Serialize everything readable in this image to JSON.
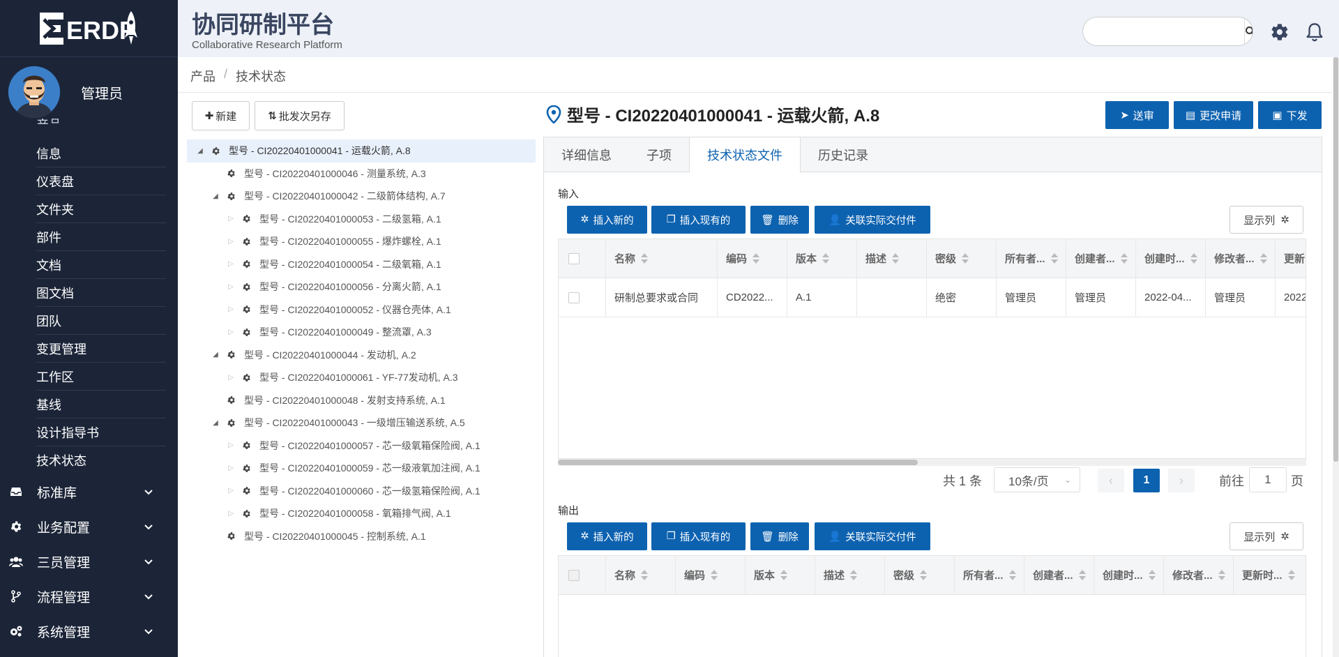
{
  "app": {
    "logo_text": "ERDP",
    "title": "协同研制平台",
    "subtitle": "Collaborative Research Platform",
    "search_placeholder": ""
  },
  "user": {
    "name": "管理员"
  },
  "sidebar": {
    "partial_label": "产品",
    "sub_items": [
      "信息",
      "仪表盘",
      "文件夹",
      "部件",
      "文档",
      "图文档",
      "团队",
      "变更管理",
      "工作区",
      "基线",
      "设计指导书",
      "技术状态"
    ],
    "main_items": [
      {
        "label": "标准库",
        "icon": "inbox-icon"
      },
      {
        "label": "业务配置",
        "icon": "gear-icon"
      },
      {
        "label": "三员管理",
        "icon": "users-icon"
      },
      {
        "label": "流程管理",
        "icon": "branch-icon"
      },
      {
        "label": "系统管理",
        "icon": "cogs-icon"
      }
    ]
  },
  "breadcrumb": {
    "items": [
      "产品",
      "技术状态"
    ],
    "separator": "/"
  },
  "left_toolbar": {
    "new_label": "新建",
    "batch_label": "批发次另存"
  },
  "tree": [
    {
      "level": 0,
      "toggle": "expanded",
      "label": "型号 - CI20220401000041 - 运载火箭, A.8",
      "selected": true
    },
    {
      "level": 1,
      "toggle": "none",
      "label": "型号 - CI20220401000046 - 测量系统, A.3"
    },
    {
      "level": 1,
      "toggle": "expanded",
      "label": "型号 - CI20220401000042 - 二级箭体结构, A.7"
    },
    {
      "level": 2,
      "toggle": "collapsed",
      "label": "型号 - CI20220401000053 - 二级氢箱, A.1"
    },
    {
      "level": 2,
      "toggle": "collapsed",
      "label": "型号 - CI20220401000055 - 爆炸螺栓, A.1"
    },
    {
      "level": 2,
      "toggle": "collapsed",
      "label": "型号 - CI20220401000054 - 二级氧箱, A.1"
    },
    {
      "level": 2,
      "toggle": "collapsed",
      "label": "型号 - CI20220401000056 - 分离火箭, A.1"
    },
    {
      "level": 2,
      "toggle": "collapsed",
      "label": "型号 - CI20220401000052 - 仪器仓壳体, A.1"
    },
    {
      "level": 2,
      "toggle": "collapsed",
      "label": "型号 - CI20220401000049 - 整流罩, A.3"
    },
    {
      "level": 1,
      "toggle": "expanded",
      "label": "型号 - CI20220401000044 - 发动机, A.2"
    },
    {
      "level": 2,
      "toggle": "collapsed",
      "label": "型号 - CI20220401000061 - YF-77发动机, A.3"
    },
    {
      "level": 1,
      "toggle": "none",
      "label": "型号 - CI20220401000048 - 发射支持系统, A.1"
    },
    {
      "level": 1,
      "toggle": "expanded",
      "label": "型号 - CI20220401000043 - 一级增压输送系统, A.5"
    },
    {
      "level": 2,
      "toggle": "collapsed",
      "label": "型号 - CI20220401000057 - 芯一级氧箱保险阀, A.1"
    },
    {
      "level": 2,
      "toggle": "collapsed",
      "label": "型号 - CI20220401000059 - 芯一级液氧加注阀, A.1"
    },
    {
      "level": 2,
      "toggle": "collapsed",
      "label": "型号 - CI20220401000060 - 芯一级氢箱保险阀, A.1"
    },
    {
      "level": 2,
      "toggle": "collapsed",
      "label": "型号 - CI20220401000058 - 氧箱排气阀, A.1"
    },
    {
      "level": 1,
      "toggle": "none",
      "label": "型号 - CI20220401000045 - 控制系统, A.1"
    }
  ],
  "detail": {
    "title": "型号 - CI20220401000041 - 运载火箭, A.8",
    "actions": {
      "submit": "送审",
      "change_request": "更改申请",
      "issue": "下发"
    },
    "tabs": [
      "详细信息",
      "子项",
      "技术状态文件",
      "历史记录"
    ],
    "active_tab": 2
  },
  "input_section": {
    "label": "输入",
    "buttons": {
      "insert_new": "插入新的",
      "insert_existing": "插入现有的",
      "delete": "删除",
      "link": "关联实际交付件"
    },
    "show_columns": "显示列",
    "columns": [
      "名称",
      "编码",
      "版本",
      "描述",
      "密级",
      "所有者...",
      "创建者...",
      "创建时...",
      "修改者...",
      "更新"
    ],
    "rows": [
      [
        "研制总要求或合同",
        "CD2022...",
        "A.1",
        "",
        "绝密",
        "管理员",
        "管理员",
        "2022-04...",
        "管理员",
        "2022"
      ]
    ],
    "pagination": {
      "total": "共 1 条",
      "page_size": "10条/页",
      "current_page": "1",
      "goto_label": "前往",
      "goto_value": "1",
      "page_suffix": "页"
    }
  },
  "output_section": {
    "label": "输出",
    "buttons": {
      "insert_new": "插入新的",
      "insert_existing": "插入现有的",
      "delete": "删除",
      "link": "关联实际交付件"
    },
    "show_columns": "显示列",
    "columns": [
      "名称",
      "编码",
      "版本",
      "描述",
      "密级",
      "所有者...",
      "创建者...",
      "创建时...",
      "修改者...",
      "更新时..."
    ]
  },
  "colors": {
    "primary": "#0d62b0",
    "sidebar": "#1c2538",
    "header_bg": "#eef2f8"
  }
}
